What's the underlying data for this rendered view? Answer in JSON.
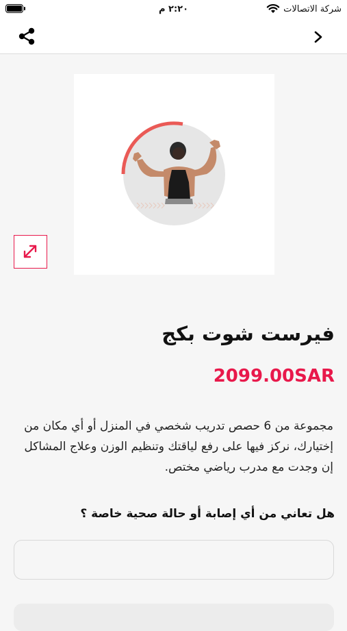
{
  "status_bar": {
    "carrier": "شركة الاتصالات",
    "time": "٢:٢٠ م"
  },
  "nav": {
    "share_icon": "share-icon",
    "back_icon": "chevron-right-icon"
  },
  "product": {
    "title": "فيرست شوت بكج",
    "price": "2099.00SAR",
    "description": "مجموعة من 6 حصص تدريب شخصي في المنزل أو أي مكان من إختيارك، نركز فيها على رفع لياقتك وتنظيم الوزن وعلاج المشاكل إن وجدت مع مدرب رياضي مختص.",
    "expand_icon": "expand-icon"
  },
  "form": {
    "question": "هل تعاني من أي إصابة أو حالة صحية خاصة ؟",
    "answer_value": "",
    "answer_placeholder": ""
  },
  "colors": {
    "accent": "#e8194b",
    "background": "#f6f6f6"
  }
}
